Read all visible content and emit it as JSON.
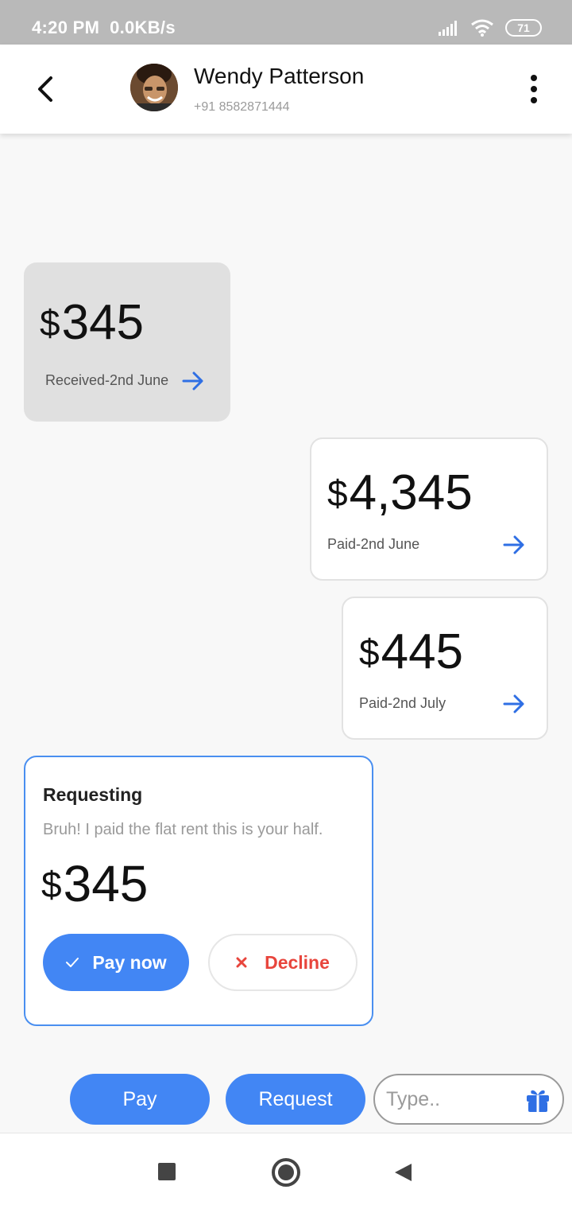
{
  "status_bar": {
    "time": "4:20 PM",
    "speed": "0.0KB/s",
    "battery": "71"
  },
  "header": {
    "contact_name": "Wendy Patterson",
    "contact_phone": "+91 8582871444",
    "back_icon": "chevron-left-icon",
    "menu_icon": "more-vert-icon"
  },
  "transactions": [
    {
      "currency": "$",
      "amount": "345",
      "caption": "Received-2nd June",
      "direction": "received"
    },
    {
      "currency": "$",
      "amount": "4,345",
      "caption": "Paid-2nd June",
      "direction": "paid"
    },
    {
      "currency": "$",
      "amount": "445",
      "caption": "Paid-2nd July",
      "direction": "paid"
    }
  ],
  "request": {
    "title": "Requesting",
    "note": "Bruh! I paid the flat rent this is your half.",
    "currency": "$",
    "amount": "345",
    "pay_now_label": "Pay now",
    "decline_label": "Decline"
  },
  "composer": {
    "pay_label": "Pay",
    "request_label": "Request",
    "placeholder": "Type..",
    "gift_icon": "gift-icon"
  },
  "colors": {
    "accent": "#4286f4",
    "decline": "#e8453c",
    "card_border": "#4a8ff0"
  }
}
